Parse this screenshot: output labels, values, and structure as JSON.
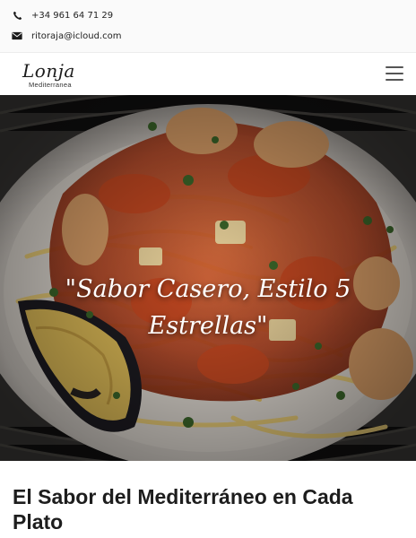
{
  "contact": {
    "phone": "+34 961 64 71 29",
    "email": "ritoraja@icloud.com",
    "phone_icon": "phone-icon",
    "email_icon": "envelope-icon"
  },
  "header": {
    "logo_script": "Lonja",
    "logo_sub": "Mediterranea",
    "menu_icon": "hamburger-menu-icon"
  },
  "hero": {
    "tagline": "\"Sabor Casero, Estilo 5 Estrellas\""
  },
  "section": {
    "title": "El Sabor del Mediterráneo en Cada Plato"
  },
  "colors": {
    "text_dark": "#1d1d1d",
    "sauce": "#c8502a",
    "background": "#ffffff"
  }
}
